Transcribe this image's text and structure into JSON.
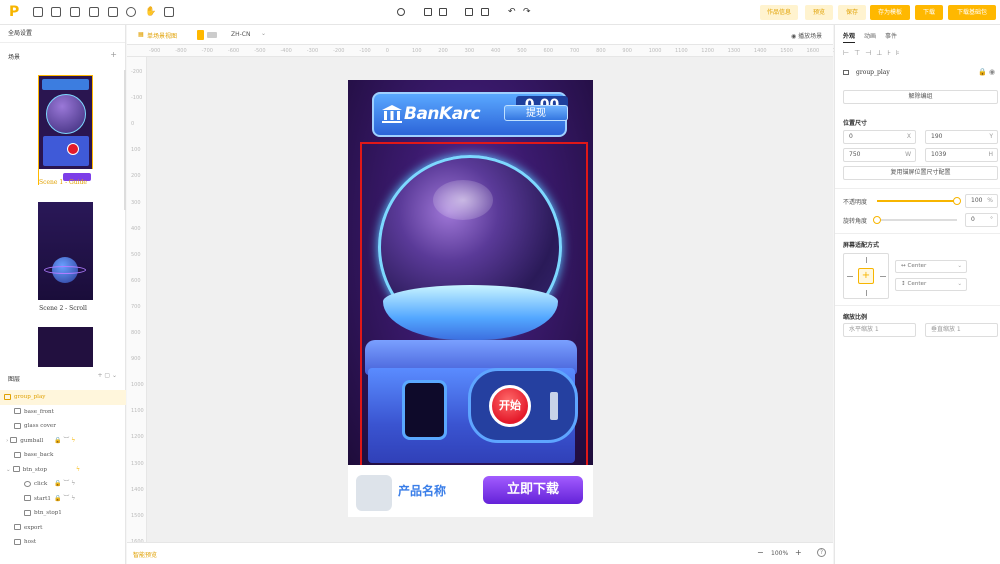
{
  "topbar": {
    "logo": "P",
    "buttons": {
      "work_info": "作品信息",
      "preview": "预览",
      "save": "保存",
      "save_as_template": "存为模板",
      "download": "下载",
      "download_assets": "下载基础包"
    }
  },
  "left": {
    "global_settings": "全局设置",
    "scenes_title": "场景",
    "scenes": [
      {
        "label": "Scene 1 - Guide"
      },
      {
        "label": "Scene 2 - Scroll"
      }
    ],
    "layers_title": "图层",
    "layers": [
      {
        "name": "group_play"
      },
      {
        "name": "base_front"
      },
      {
        "name": "glass cover"
      },
      {
        "name": "gumball"
      },
      {
        "name": "base_back"
      },
      {
        "name": "btn_stop"
      },
      {
        "name": "click"
      },
      {
        "name": "start1"
      },
      {
        "name": "btn_stop1"
      },
      {
        "name": "export"
      },
      {
        "name": "host"
      }
    ]
  },
  "canvas": {
    "view_label": "单场景视图",
    "language": "ZH-CN",
    "play_scene": "播放场景",
    "ruler_h": [
      "-900",
      "-800",
      "-700",
      "-600",
      "-500",
      "-400",
      "-300",
      "-200",
      "-100",
      "0",
      "100",
      "200",
      "300",
      "400",
      "500",
      "600",
      "700",
      "800",
      "900",
      "1000",
      "1100",
      "1200",
      "1300",
      "1400",
      "1500",
      "1600",
      "17"
    ],
    "ruler_v": [
      "-200",
      "-100",
      "0",
      "100",
      "200",
      "300",
      "400",
      "500",
      "600",
      "700",
      "800",
      "900",
      "1000",
      "1100",
      "1200",
      "1300",
      "1400",
      "1500",
      "1600"
    ],
    "bottom_left": "智能预览",
    "zoom": "100%",
    "zoom_minus": "−",
    "zoom_plus": "+",
    "game": {
      "bank_name": "BanKarc",
      "amount": "0.00",
      "withdraw": "提现",
      "start": "开始",
      "product_name": "产品名称",
      "download_now": "立即下载"
    }
  },
  "right": {
    "tabs": [
      "外观",
      "动画",
      "事件"
    ],
    "object_name": "group_play",
    "unbind": "解除编组",
    "size_title": "位置尺寸",
    "x": "0",
    "x_unit": "X",
    "y": "190",
    "y_unit": "Y",
    "w": "750",
    "w_unit": "W",
    "h": "1039",
    "h_unit": "H",
    "reuse_config": "复用锚屏位置尺寸配置",
    "opacity_label": "不透明度",
    "opacity_value": "100",
    "opacity_unit": "%",
    "opacity_level": 100,
    "rotation_label": "旋转角度",
    "rotation_value": "0",
    "rotation_unit": "°",
    "fit_title": "屏幕适配方式",
    "fit_h": "Center",
    "fit_v": "Center",
    "scale_title": "缩放比例",
    "scale_h": "水平缩放  1",
    "scale_v": "垂直缩放  1"
  },
  "colors": {
    "accent": "#ffb800",
    "selection": "#e01818"
  }
}
